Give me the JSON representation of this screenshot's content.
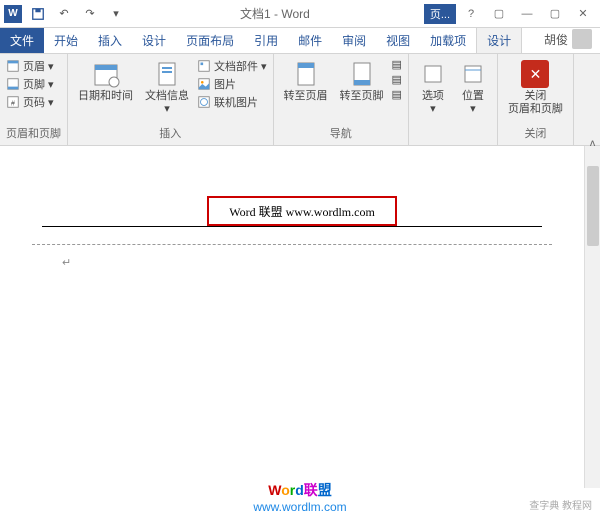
{
  "titlebar": {
    "app_letter": "W",
    "title": "文档1 - Word",
    "page_tab": "页...",
    "help": "?",
    "user_name": "胡俊"
  },
  "tabs": {
    "file": "文件",
    "home": "开始",
    "insert": "插入",
    "design": "设计",
    "layout": "页面布局",
    "references": "引用",
    "mailings": "邮件",
    "review": "审阅",
    "view": "视图",
    "addins": "加载项",
    "hf_design": "设计"
  },
  "ribbon": {
    "g1": {
      "header": "页眉",
      "footer": "页脚",
      "pagenum": "页码",
      "label": "页眉和页脚"
    },
    "g2": {
      "datetime": "日期和时间",
      "docinfo": "文档信息",
      "docparts": "文档部件",
      "picture": "图片",
      "online_pic": "联机图片",
      "label": "插入"
    },
    "g3": {
      "goto_header": "转至页眉",
      "goto_footer": "转至页脚",
      "label": "导航"
    },
    "g4": {
      "options": "选项",
      "position": "位置"
    },
    "g5": {
      "close": "关闭\n页眉和页脚",
      "label": "关闭"
    }
  },
  "document": {
    "header_text": "Word 联盟  www.wordlm.com",
    "para_mark": "↵"
  },
  "watermark": {
    "w": "W",
    "o": "o",
    "r": "r",
    "d": "d",
    "lian": "联",
    "meng": "盟",
    "url": "www.wordlm.com",
    "right": "查字典 教程网"
  }
}
